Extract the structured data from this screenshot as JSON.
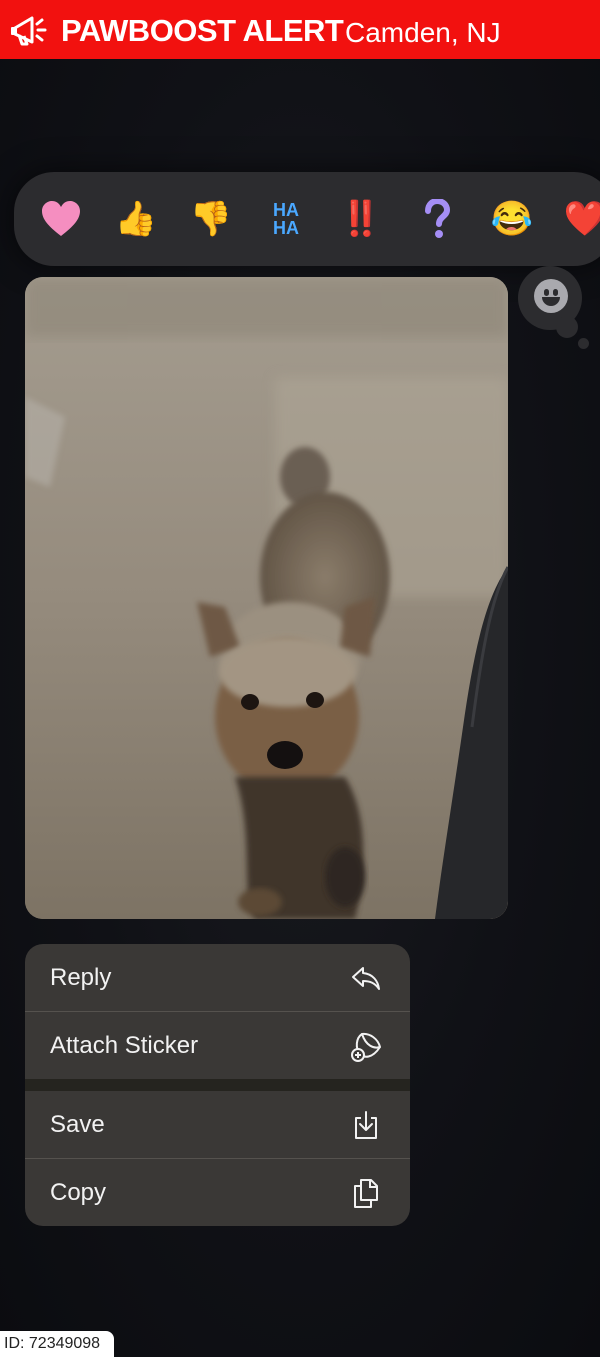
{
  "banner": {
    "brand": "PAWBOOST ALERT",
    "city": "Camden, NJ",
    "color": "#f2110f",
    "icon": "megaphone-icon"
  },
  "reactions": [
    {
      "name": "heart",
      "glyph": "🩷"
    },
    {
      "name": "thumbs-up",
      "glyph": "👍"
    },
    {
      "name": "thumbs-down",
      "glyph": "👎"
    },
    {
      "name": "haha",
      "glyph": "HA"
    },
    {
      "name": "exclamation",
      "glyph": "‼️"
    },
    {
      "name": "question",
      "glyph": "❓"
    },
    {
      "name": "tears-of-joy",
      "glyph": "😂"
    },
    {
      "name": "more",
      "glyph": "❤️"
    }
  ],
  "menu": {
    "reply": {
      "label": "Reply",
      "icon": "reply-arrow-icon"
    },
    "attach_sticker": {
      "label": "Attach Sticker",
      "icon": "sticker-icon"
    },
    "save": {
      "label": "Save",
      "icon": "save-download-icon"
    },
    "copy": {
      "label": "Copy",
      "icon": "copy-icon"
    }
  },
  "footer": {
    "id_text": "ID: 72349098"
  }
}
